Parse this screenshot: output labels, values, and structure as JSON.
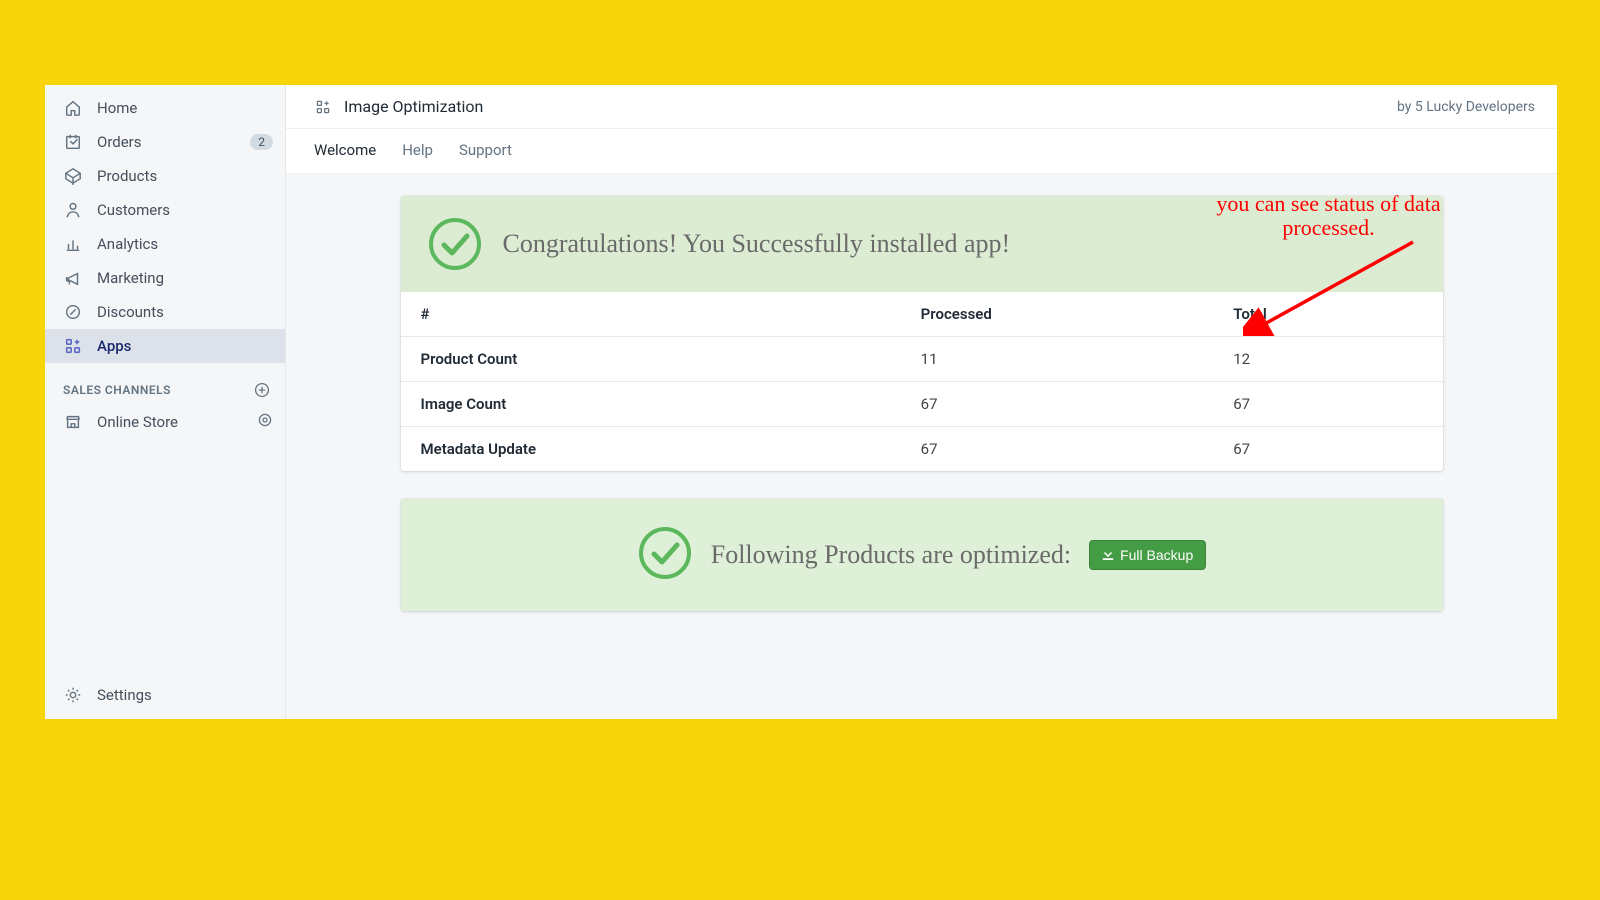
{
  "sidebar": {
    "items": [
      {
        "label": "Home"
      },
      {
        "label": "Orders",
        "badge": "2"
      },
      {
        "label": "Products"
      },
      {
        "label": "Customers"
      },
      {
        "label": "Analytics"
      },
      {
        "label": "Marketing"
      },
      {
        "label": "Discounts"
      },
      {
        "label": "Apps"
      }
    ],
    "section": "SALES CHANNELS",
    "channels": [
      {
        "label": "Online Store"
      }
    ],
    "settings": "Settings"
  },
  "appbar": {
    "title": "Image Optimization",
    "byline": "by 5 Lucky Developers"
  },
  "tabs": {
    "welcome": "Welcome",
    "help": "Help",
    "support": "Support"
  },
  "alert1": "Congratulations! You Successfully installed app!",
  "status_table": {
    "headers": {
      "num": "#",
      "processed": "Processed",
      "total": "Total"
    },
    "rows": [
      {
        "name": "Product Count",
        "processed": "11",
        "total": "12"
      },
      {
        "name": "Image Count",
        "processed": "67",
        "total": "67"
      },
      {
        "name": "Metadata Update",
        "processed": "67",
        "total": "67"
      }
    ]
  },
  "alert2": {
    "text": "Following Products are optimized:",
    "button": "Full Backup"
  },
  "annotation": "you can see status of data processed."
}
